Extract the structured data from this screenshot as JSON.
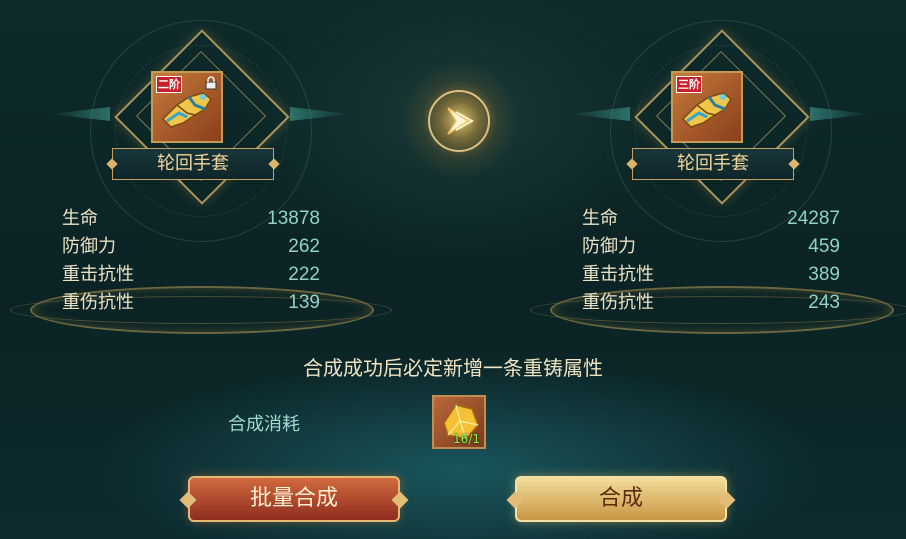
{
  "left_item": {
    "grade": "二阶",
    "name": "轮回手套",
    "locked": true,
    "stats": [
      {
        "label": "生命",
        "value": "13878"
      },
      {
        "label": "防御力",
        "value": "262"
      },
      {
        "label": "重击抗性",
        "value": "222"
      },
      {
        "label": "重伤抗性",
        "value": "139"
      }
    ]
  },
  "right_item": {
    "grade": "三阶",
    "name": "轮回手套",
    "locked": false,
    "stats": [
      {
        "label": "生命",
        "value": "24287"
      },
      {
        "label": "防御力",
        "value": "459"
      },
      {
        "label": "重击抗性",
        "value": "389"
      },
      {
        "label": "重伤抗性",
        "value": "243"
      }
    ]
  },
  "note": "合成成功后必定新增一条重铸属性",
  "cost": {
    "label": "合成消耗",
    "material_icon": "gold-crystal-icon",
    "count": "16/1"
  },
  "buttons": {
    "batch_label": "批量合成",
    "merge_label": "合成"
  },
  "colors": {
    "accent_gold": "#d6b268",
    "stat_value": "#8fd3c9",
    "count_green": "#7dff4a"
  }
}
